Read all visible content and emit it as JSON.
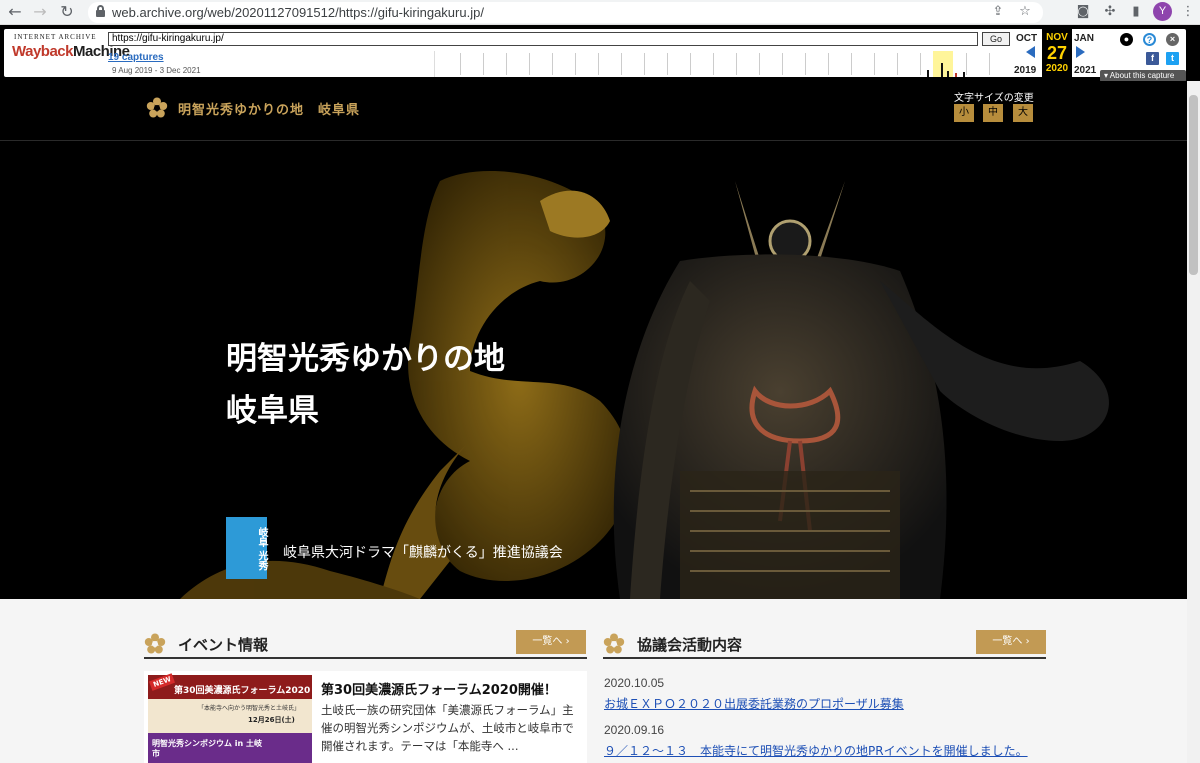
{
  "browser": {
    "url": "web.archive.org/web/20201127091512/https://gifu-kiringakuru.jp/",
    "avatar_initial": "Y"
  },
  "wayback": {
    "logo_top": "INTERNET ARCHIVE",
    "logo_a": "Wayback",
    "logo_b": "Machine",
    "url_input": "https://gifu-kiringakuru.jp/",
    "go_label": "Go",
    "captures": "19 captures",
    "date_range": "9 Aug 2019 - 3 Dec 2021",
    "prev_month": "OCT",
    "cur_month": "NOV",
    "next_month": "JAN",
    "cur_day": "27",
    "prev_year": "2019",
    "cur_year": "2020",
    "next_year": "2021",
    "about": "About this capture",
    "facebook": "f",
    "twitter": "t",
    "help": "?",
    "close": "×"
  },
  "header": {
    "site_title": "明智光秀ゆかりの地　岐阜県",
    "font_size_label": "文字サイズの変更",
    "font_sizes": [
      "小",
      "中",
      "大"
    ]
  },
  "hero": {
    "title_line1": "明智光秀ゆかりの地",
    "title_line2": "岐阜県",
    "badge_text": "岐阜 光秀",
    "subtitle": "岐阜県大河ドラマ「麒麟がくる」推進協議会"
  },
  "events": {
    "title": "イベント情報",
    "more": "一覧へ ›",
    "item_title": "第30回美濃源氏フォーラム2020開催！",
    "item_desc": "土岐氏一族の研究団体「美濃源氏フォーラム」主催の明智光秀シンポジウムが、土岐市と岐阜市で開催されます。テーマは「本能寺へ ...",
    "img_badge": "NEW",
    "img_title": "第30回美濃源氏フォーラム2020",
    "img_sub": "「本能寺へ向かう明智光秀と土岐氏」",
    "img_date": "12月26日(土)",
    "img_bottom": "明智光秀シンポジウム in 土岐市"
  },
  "activities": {
    "title": "協議会活動内容",
    "more": "一覧へ ›",
    "items": [
      {
        "date": "2020.10.05",
        "text": "お城ＥＸＰＯ２０２０出展委託業務のプロポーザル募集"
      },
      {
        "date": "2020.09.16",
        "text": "９／１２～１３　本能寺にて明智光秀ゆかりの地PRイベントを開催しました。"
      }
    ]
  },
  "colors": {
    "gold": "#c9a35b",
    "button_gold": "#c29a54",
    "badge_blue": "#2d9ad7",
    "link_blue": "#1d4fb5"
  }
}
